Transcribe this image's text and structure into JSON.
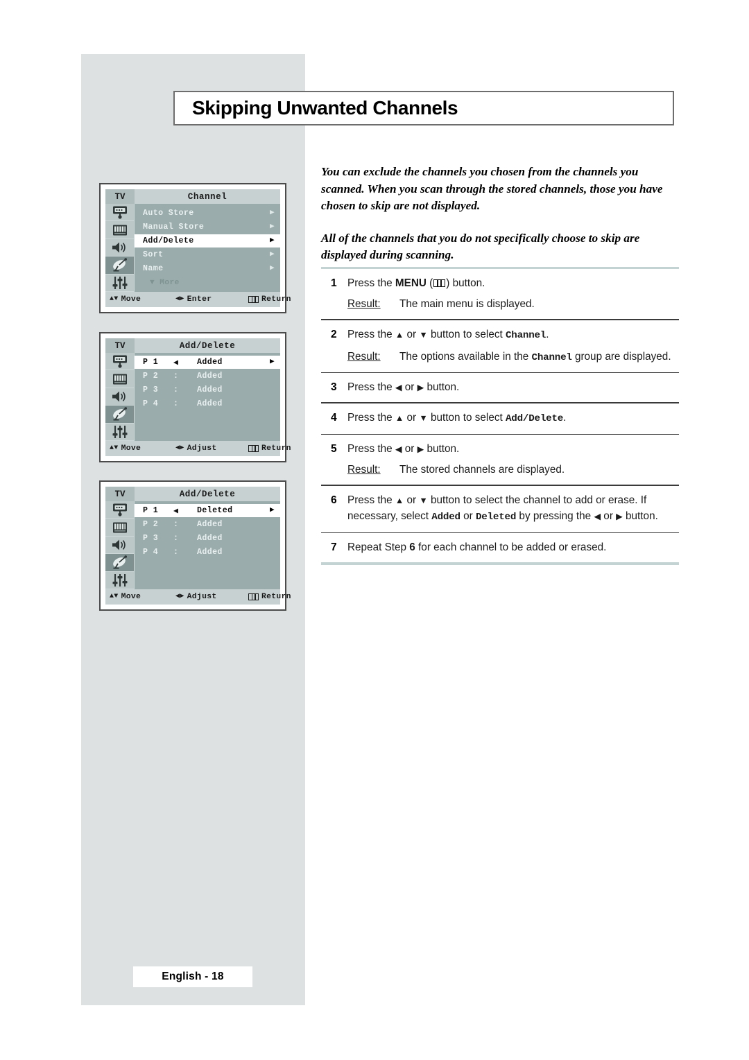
{
  "page": {
    "title": "Skipping Unwanted Channels",
    "footer_label": "English - 18",
    "accent_rule_color": "#c3d3d4",
    "panel_color": "#dde1e1"
  },
  "intro": {
    "paragraph1": "You can exclude the channels you chosen from the channels you scanned. When you scan through the stored channels, those you have chosen to skip are not displayed.",
    "paragraph2": "All of the channels that you do not specifically choose to skip are displayed during scanning."
  },
  "steps": [
    {
      "num": "1",
      "text_pre": "Press the ",
      "text_bold": "MENU",
      "text_post": ") button.",
      "result_label": "Result:",
      "result_text": "The main menu is displayed."
    },
    {
      "num": "2",
      "text_pre": "Press the ",
      "up": "▲",
      "or": " or ",
      "down": "▼",
      "text_mid": " button to select ",
      "mono": "Channel",
      "text_post": ".",
      "result_label": "Result:",
      "result_pre": "The options available in the ",
      "result_mono": "Channel",
      "result_post": " group are displayed."
    },
    {
      "num": "3",
      "text_pre": "Press the ",
      "left": "◀",
      "or": " or ",
      "right": "▶",
      "text_post": " button."
    },
    {
      "num": "4",
      "text_pre": "Press the ",
      "up": "▲",
      "or": " or ",
      "down": "▼",
      "text_mid": " button to select  ",
      "mono": "Add/Delete",
      "text_post": "."
    },
    {
      "num": "5",
      "text_pre": "Press the ",
      "left": "◀",
      "or": " or ",
      "right": "▶",
      "text_post": " button.",
      "result_label": "Result:",
      "result_text": "The stored channels are displayed."
    },
    {
      "num": "6",
      "text_pre": "Press the ",
      "up": "▲",
      "or": " or ",
      "down": "▼",
      "text_mid": " button to select the channel to add or erase. If necessary, select ",
      "mono1": "Added",
      "text_mid2": " or ",
      "mono2": "Deleted",
      "text_mid3": " by pressing the ",
      "left": "◀",
      "right": "▶",
      "text_post": " button."
    },
    {
      "num": "7",
      "text_pre": "Repeat Step ",
      "bold": "6",
      "text_post": " for each channel to be added or erased."
    }
  ],
  "osd_menus": [
    {
      "tv_label": "TV",
      "title": "Channel",
      "rail_icons": [
        "tv-icon",
        "picture-icon",
        "sound-icon",
        "channel-dish-icon",
        "setup-sliders-icon"
      ],
      "selected_rail_index": 3,
      "rows": [
        {
          "label": "Auto Store",
          "arrow": "▶",
          "highlighted": false
        },
        {
          "label": "Manual Store",
          "arrow": "▶",
          "highlighted": false
        },
        {
          "label": "Add/Delete",
          "arrow": "▶",
          "highlighted": true
        },
        {
          "label": "Sort",
          "arrow": "▶",
          "highlighted": false
        },
        {
          "label": "Name",
          "arrow": "▶",
          "highlighted": false
        }
      ],
      "more_label": "▼ More",
      "bottom": {
        "move": "Move",
        "mid": "Enter",
        "return": "Return"
      }
    },
    {
      "tv_label": "TV",
      "title": "Add/Delete",
      "rail_icons": [
        "tv-icon",
        "picture-icon",
        "sound-icon",
        "channel-dish-icon",
        "setup-sliders-icon"
      ],
      "selected_rail_index": 3,
      "channel_rows": [
        {
          "ch": "P 1",
          "sep": "◀",
          "value": "Added",
          "arrow": "▶",
          "highlighted": true
        },
        {
          "ch": "P 2",
          "sep": ":",
          "value": "Added",
          "arrow": "",
          "highlighted": false
        },
        {
          "ch": "P 3",
          "sep": ":",
          "value": "Added",
          "arrow": "",
          "highlighted": false
        },
        {
          "ch": "P 4",
          "sep": ":",
          "value": "Added",
          "arrow": "",
          "highlighted": false
        }
      ],
      "bottom": {
        "move": "Move",
        "mid": "Adjust",
        "return": "Return"
      }
    },
    {
      "tv_label": "TV",
      "title": "Add/Delete",
      "rail_icons": [
        "tv-icon",
        "picture-icon",
        "sound-icon",
        "channel-dish-icon",
        "setup-sliders-icon"
      ],
      "selected_rail_index": 3,
      "channel_rows": [
        {
          "ch": "P 1",
          "sep": "◀",
          "value": "Deleted",
          "arrow": "▶",
          "highlighted": true
        },
        {
          "ch": "P 2",
          "sep": ":",
          "value": "Added",
          "arrow": "",
          "highlighted": false
        },
        {
          "ch": "P 3",
          "sep": ":",
          "value": "Added",
          "arrow": "",
          "highlighted": false
        },
        {
          "ch": "P 4",
          "sep": ":",
          "value": "Added",
          "arrow": "",
          "highlighted": false
        }
      ],
      "bottom": {
        "move": "Move",
        "mid": "Adjust",
        "return": "Return"
      }
    }
  ]
}
